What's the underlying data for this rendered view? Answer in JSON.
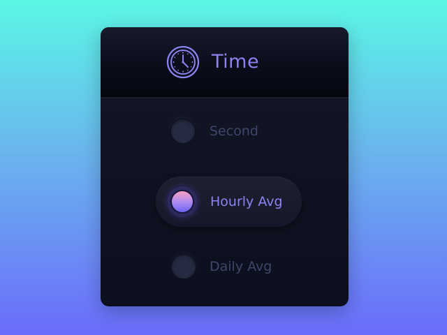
{
  "panel": {
    "title": "Time",
    "title_icon": "clock-icon",
    "options": [
      {
        "label": "Second",
        "selected": false
      },
      {
        "label": "Hourly Avg",
        "selected": true
      },
      {
        "label": "Daily Avg",
        "selected": false
      }
    ]
  },
  "colors": {
    "accent": "#8b83f0",
    "card_bg": "#0f1222",
    "inactive_text": "#41456a",
    "background_top": "#5bf7e6",
    "background_bottom": "#6b6cfb"
  }
}
